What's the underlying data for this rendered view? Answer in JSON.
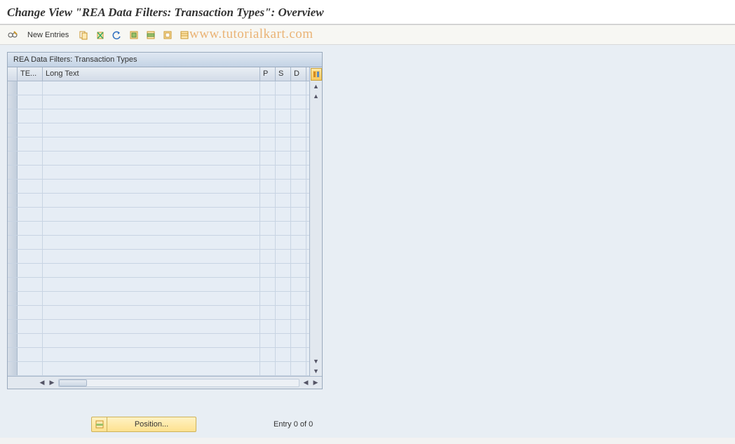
{
  "page_title": "Change View \"REA Data Filters: Transaction Types\": Overview",
  "toolbar": {
    "new_entries_label": "New Entries"
  },
  "watermark": "www.tutorialkart.com",
  "grid": {
    "title": "REA Data Filters: Transaction Types",
    "columns": {
      "te": "TE...",
      "long_text": "Long Text",
      "p": "P",
      "s": "S",
      "d": "D"
    },
    "rows": [
      {
        "te": "",
        "long_text": "",
        "p": "",
        "s": "",
        "d": ""
      },
      {
        "te": "",
        "long_text": "",
        "p": "",
        "s": "",
        "d": ""
      },
      {
        "te": "",
        "long_text": "",
        "p": "",
        "s": "",
        "d": ""
      },
      {
        "te": "",
        "long_text": "",
        "p": "",
        "s": "",
        "d": ""
      },
      {
        "te": "",
        "long_text": "",
        "p": "",
        "s": "",
        "d": ""
      },
      {
        "te": "",
        "long_text": "",
        "p": "",
        "s": "",
        "d": ""
      },
      {
        "te": "",
        "long_text": "",
        "p": "",
        "s": "",
        "d": ""
      },
      {
        "te": "",
        "long_text": "",
        "p": "",
        "s": "",
        "d": ""
      },
      {
        "te": "",
        "long_text": "",
        "p": "",
        "s": "",
        "d": ""
      },
      {
        "te": "",
        "long_text": "",
        "p": "",
        "s": "",
        "d": ""
      },
      {
        "te": "",
        "long_text": "",
        "p": "",
        "s": "",
        "d": ""
      },
      {
        "te": "",
        "long_text": "",
        "p": "",
        "s": "",
        "d": ""
      },
      {
        "te": "",
        "long_text": "",
        "p": "",
        "s": "",
        "d": ""
      },
      {
        "te": "",
        "long_text": "",
        "p": "",
        "s": "",
        "d": ""
      },
      {
        "te": "",
        "long_text": "",
        "p": "",
        "s": "",
        "d": ""
      },
      {
        "te": "",
        "long_text": "",
        "p": "",
        "s": "",
        "d": ""
      },
      {
        "te": "",
        "long_text": "",
        "p": "",
        "s": "",
        "d": ""
      },
      {
        "te": "",
        "long_text": "",
        "p": "",
        "s": "",
        "d": ""
      },
      {
        "te": "",
        "long_text": "",
        "p": "",
        "s": "",
        "d": ""
      },
      {
        "te": "",
        "long_text": "",
        "p": "",
        "s": "",
        "d": ""
      },
      {
        "te": "",
        "long_text": "",
        "p": "",
        "s": "",
        "d": ""
      }
    ]
  },
  "footer": {
    "position_label": "Position...",
    "entry_text": "Entry 0 of 0"
  }
}
